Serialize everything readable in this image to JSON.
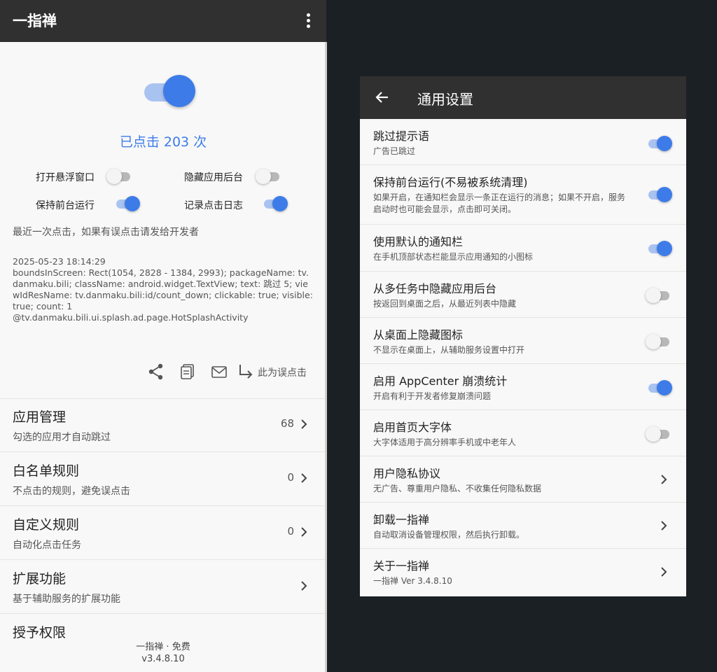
{
  "left": {
    "app_title": "一指禅",
    "click_count": "已点击 203 次",
    "options": [
      {
        "label": "打开悬浮窗口",
        "on": false
      },
      {
        "label": "隐藏应用后台",
        "on": false
      },
      {
        "label": "保持前台运行",
        "on": true
      },
      {
        "label": "记录点击日志",
        "on": true
      }
    ],
    "last_click_hint": "最近一次点击，如果有误点击请发给开发者",
    "log": "2025-05-23 18:14:29\nboundsInScreen: Rect(1054, 2828 - 1384, 2993); packageName: tv.danmaku.bili; className: android.widget.TextView; text: 跳过 5; viewIdResName: tv.danmaku.bili:id/count_down; clickable: true; visible: true; count: 1\n@tv.danmaku.bili.ui.splash.ad.page.HotSplashActivity",
    "misclick_label": "此为误点击",
    "icons": [
      "share-icon",
      "copy-icon",
      "mail-icon",
      "redirect-icon"
    ],
    "list": [
      {
        "title": "应用管理",
        "subtitle": "勾选的应用才自动跳过",
        "count": "68"
      },
      {
        "title": "白名单规则",
        "subtitle": "不点击的规则，避免误点击",
        "count": "0"
      },
      {
        "title": "自定义规则",
        "subtitle": "自动化点击任务",
        "count": "0"
      },
      {
        "title": "扩展功能",
        "subtitle": "基于辅助服务的扩展功能",
        "count": ""
      },
      {
        "title": "授予权限",
        "subtitle": "",
        "count": ""
      }
    ],
    "footer_line1": "一指禅 · 免费",
    "footer_line2": "v3.4.8.10"
  },
  "right": {
    "title": "通用设置",
    "settings": [
      {
        "title": "跳过提示语",
        "subtitle": "广告已跳过",
        "type": "toggle",
        "on": true
      },
      {
        "title": "保持前台运行(不易被系统清理)",
        "subtitle": "如果开启，在通知栏会显示一条正在运行的消息；如果不开启，服务启动时也可能会显示，点击即可关闭。",
        "type": "toggle",
        "on": true
      },
      {
        "title": "使用默认的通知栏",
        "subtitle": "在手机顶部状态栏能显示应用通知的小图标",
        "type": "toggle",
        "on": true
      },
      {
        "title": "从多任务中隐藏应用后台",
        "subtitle": "按返回到桌面之后，从最近列表中隐藏",
        "type": "toggle",
        "on": false
      },
      {
        "title": "从桌面上隐藏图标",
        "subtitle": "不显示在桌面上，从辅助服务设置中打开",
        "type": "toggle",
        "on": false
      },
      {
        "title": "启用 AppCenter 崩溃统计",
        "subtitle": "开启有利于开发者修复崩溃问题",
        "type": "toggle",
        "on": true
      },
      {
        "title": "启用首页大字体",
        "subtitle": "大字体适用于高分辨率手机或中老年人",
        "type": "toggle",
        "on": false
      },
      {
        "title": "用户隐私协议",
        "subtitle": "无广告、尊重用户隐私、不收集任何隐私数据",
        "type": "link"
      },
      {
        "title": "卸载一指禅",
        "subtitle": "自动取消设备管理权限，然后执行卸载。",
        "type": "link"
      },
      {
        "title": "关于一指禅",
        "subtitle": "一指禅 Ver 3.4.8.10",
        "type": "link"
      }
    ]
  },
  "colors": {
    "accent": "#3d7ce8",
    "accent_track": "#a9c3f1",
    "appbar": "#303030",
    "background": "#1b2024",
    "surface": "#f8f8f8"
  }
}
